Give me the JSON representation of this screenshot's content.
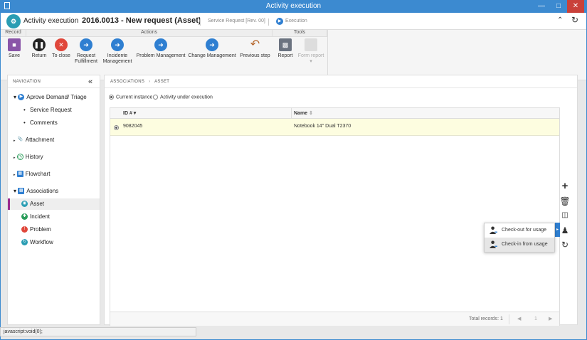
{
  "window": {
    "title": "Activity execution"
  },
  "header": {
    "app": "Activity execution",
    "record": "2016.0013 - New request (Asset)",
    "process": "Service Request [Rev. 00]",
    "status": "Execution"
  },
  "toolbar": {
    "groups": {
      "record": "Record",
      "actions": "Actions",
      "tools": "Tools"
    },
    "buttons": {
      "save": "Save",
      "return": "Return",
      "close": "To close",
      "request1": "Request",
      "request2": "Fulfillment",
      "incident1": "Incidente",
      "incident2": "Management",
      "problem": "Problem Management",
      "change": "Change Management",
      "previous": "Previous step",
      "report": "Report",
      "form": "Form report"
    }
  },
  "nav": {
    "title": "NAVIGATION",
    "items": [
      {
        "label": "Aprove Demand/ Triage"
      },
      {
        "label": "Service Request"
      },
      {
        "label": "Comments"
      },
      {
        "label": "Attachment"
      },
      {
        "label": "History"
      },
      {
        "label": "Flowchart"
      },
      {
        "label": "Associations"
      },
      {
        "label": "Asset"
      },
      {
        "label": "Incident"
      },
      {
        "label": "Problem"
      },
      {
        "label": "Workflow"
      }
    ]
  },
  "content": {
    "breadcrumb": {
      "root": "ASSOCIATIONS",
      "leaf": "ASSET"
    },
    "radios": {
      "current": "Current instance",
      "activity": "Activity under execution"
    },
    "columns": {
      "id": "ID #",
      "name": "Name"
    },
    "rows": [
      {
        "id": "9082045",
        "name": "Notebook 14\" Dual T2370"
      }
    ],
    "footer": {
      "total": "Total records: 1",
      "page": "1"
    }
  },
  "menu": {
    "checkout": "Check-out for usage",
    "checkin": "Check-in from usage"
  },
  "status": "javascript:void(0);"
}
